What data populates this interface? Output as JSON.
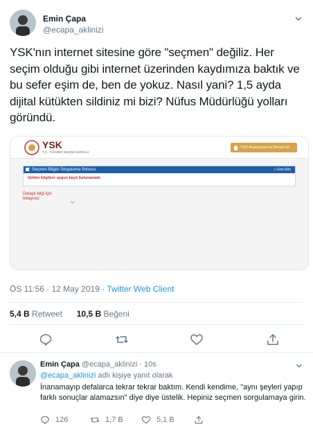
{
  "tweet": {
    "author_name": "Emin Çapa",
    "author_handle": "@ecapa_aklinizi",
    "text": "YSK'nın internet sitesine göre \"seçmen\" değiliz. Her seçim olduğu gibi internet üzerinden kaydımıza baktık ve bu sefer eşim de, ben de yokuz. Nasıl yani? 1,5 ayda dijital kütükten sildiniz mi bizi? Nüfus Müdürlüğü yolları göründü.",
    "time": "ÖS 11:56",
    "date": "12 May 2019",
    "separator": " · ",
    "client": "Twitter Web Client",
    "retweet_count": "5,4 B",
    "retweet_label": "Retweet",
    "like_count": "10,5 B",
    "like_label": "Beğeni"
  },
  "media": {
    "logo_title": "YSK",
    "logo_subtitle": "T.C. YÜKSEK SEÇİM KURULU",
    "home_button": "YSK Anasayfasına Devam Et",
    "panel_title": "Seçmen Bilgisi Sorgulama Sonucu",
    "panel_back": "Geri Dön",
    "panel_message": "Girilen bilgilere uygun kayıt bulunamadı.",
    "detail_link": "Detaylı bilgi için tıklayınız"
  },
  "reply": {
    "author_name": "Emin Çapa",
    "author_handle": "@ecapa_aklinizi",
    "age": "10s",
    "separator": " · ",
    "replying_mention": "@ecapa_aklinizi",
    "replying_suffix": " adlı kişiye yanıt olarak",
    "text": "İnanamayıp defalarca tekrar tekrar baktım. Kendi kendime, \"aynı şeyleri yapıp farklı sonuçlar alamazsın\" diye diye üstelik. Hepiniz seçmen sorgulamaya girin.",
    "reply_count": "126",
    "retweet_count": "1,7 B",
    "like_count": "5,1 B"
  },
  "colors": {
    "accent": "#1b95e0",
    "muted": "#657786",
    "ysk_red": "#7b1c1c",
    "ysk_blue": "#1f5faa",
    "ysk_gold": "#d7a34a"
  }
}
